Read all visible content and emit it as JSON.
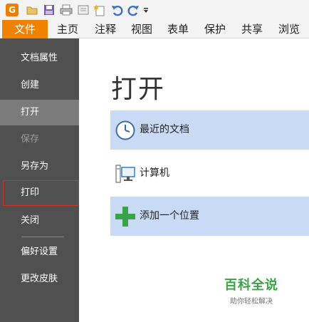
{
  "toolbar": {
    "logo_letter": "G",
    "icons": [
      "open-folder-icon",
      "save-icon",
      "print-icon",
      "print-preview-icon",
      "new-icon",
      "undo-icon",
      "redo-icon",
      "customize-dropdown-icon"
    ]
  },
  "tabs": [
    {
      "label": "文件",
      "active": true
    },
    {
      "label": "主页"
    },
    {
      "label": "注释"
    },
    {
      "label": "视图"
    },
    {
      "label": "表单"
    },
    {
      "label": "保护"
    },
    {
      "label": "共享"
    },
    {
      "label": "浏览"
    }
  ],
  "menu": {
    "items": [
      {
        "label": "文档属性"
      },
      {
        "label": "创建"
      },
      {
        "label": "打开",
        "selected": true
      },
      {
        "label": "保存",
        "disabled": true
      },
      {
        "label": "另存为"
      },
      {
        "label": "打印",
        "focused": true
      },
      {
        "label": "关闭"
      },
      {
        "label": "偏好设置"
      },
      {
        "label": "更改皮肤"
      }
    ]
  },
  "content": {
    "title": "打开",
    "options": [
      {
        "label": "最近的文档",
        "icon": "clock-icon",
        "highlighted": true
      },
      {
        "label": "计算机",
        "icon": "computer-icon",
        "highlighted": false
      },
      {
        "label": "添加一个位置",
        "icon": "plus-icon",
        "highlighted": true
      }
    ]
  },
  "watermark": {
    "title": "百科全说",
    "subtitle": "助你轻松解决"
  },
  "colors": {
    "accent": "#f08200",
    "menu_bg": "#505050",
    "highlight": "#c9daf4",
    "plus_green": "#3aa347"
  }
}
